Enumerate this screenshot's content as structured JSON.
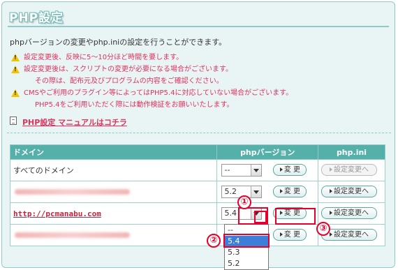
{
  "panel": {
    "title": "PHP設定"
  },
  "intro": "phpバージョンの変更やphp.iniの設定を行うことができます。",
  "notes": [
    {
      "warn": true,
      "text": "設定変更後、反映に5～10分ほど時間を要します。"
    },
    {
      "warn": true,
      "text": "設定変更後は、スクリプトの変更が必要になる場合がございます。"
    },
    {
      "warn": false,
      "text": "その際は、配布元及びプログラムの内容をご確認ください。"
    },
    {
      "warn": true,
      "text": "CMSやご利用のプラグイン等によってはPHP5.4に対応していない場合がございます。"
    },
    {
      "warn": false,
      "text": "PHP5.4をご利用いただく際には動作検証をお願いいたします。"
    }
  ],
  "manual_link": "PHP設定 マニュアルはコチラ",
  "table": {
    "headers": [
      "ドメイン",
      "phpバージョン",
      "php.ini"
    ],
    "rows": [
      {
        "domain": "すべてのドメイン",
        "blurred": false,
        "version": "--",
        "change_label": "変 更",
        "ini_label": "設定変更へ",
        "ini_disabled": true
      },
      {
        "domain": "",
        "blurred": true,
        "version": "5.2",
        "change_label": "変 更",
        "ini_label": "設定変更へ",
        "ini_disabled": false
      },
      {
        "domain": "http://pcmanabu.com",
        "blurred": false,
        "link": true,
        "version": "5.4",
        "change_label": "変 更",
        "ini_label": "設定変更へ",
        "ini_disabled": false
      },
      {
        "domain": "",
        "blurred": true,
        "version": "",
        "change_label": "変 更",
        "ini_label": "設定変更へ",
        "ini_disabled": false
      }
    ]
  },
  "dropdown": {
    "options": [
      "--",
      "5.4",
      "5.3",
      "5.2"
    ],
    "highlighted": "5.4"
  },
  "callouts": {
    "one": "①",
    "two": "②",
    "three": "③"
  },
  "colors": {
    "accent": "#55b0aa",
    "warning": "#e0325f",
    "highlight": "#e4002b",
    "selected_option": "#3d7fd8"
  },
  "icons": {
    "warning": "warning-triangle-icon",
    "manual": "document-icon",
    "button_arrow": "play-triangle-icon"
  }
}
